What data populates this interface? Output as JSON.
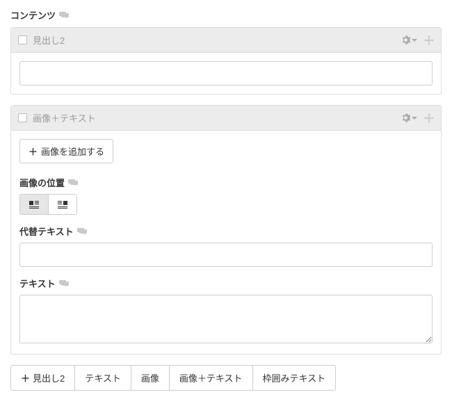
{
  "section_title": "コンテンツ",
  "block1": {
    "title": "見出し2",
    "value": ""
  },
  "block2": {
    "title": "画像＋テキスト",
    "add_image_label": "画像を追加する",
    "position_label": "画像の位置",
    "alt_text_label": "代替テキスト",
    "alt_text_value": "",
    "text_label": "テキスト",
    "text_value": ""
  },
  "bottom_buttons": {
    "heading2": "見出し2",
    "text": "テキスト",
    "image": "画像",
    "image_text": "画像＋テキスト",
    "boxed_text": "枠囲みテキスト"
  }
}
